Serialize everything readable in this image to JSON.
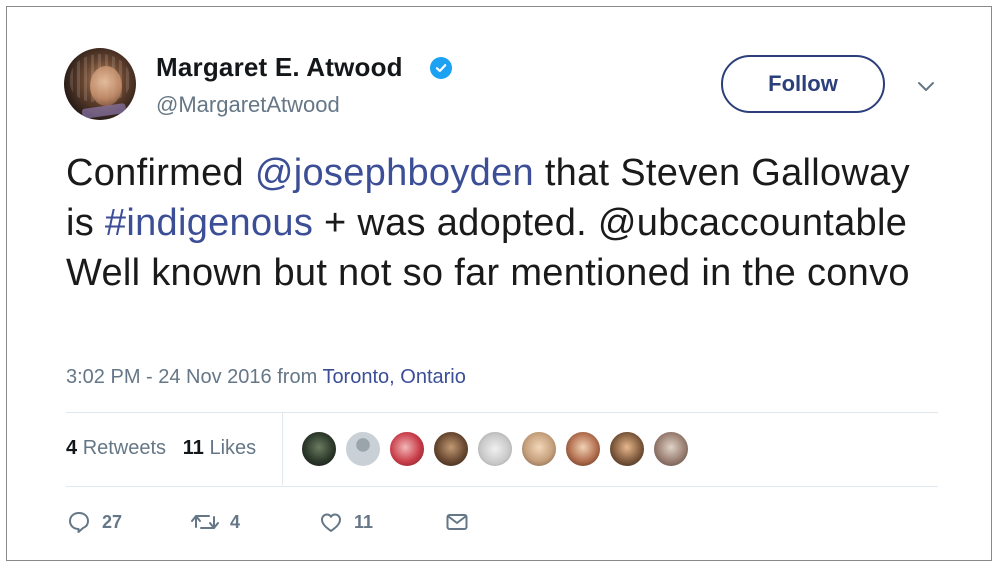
{
  "tweet": {
    "author": {
      "name": "Margaret E. Atwood",
      "handle": "@MargaretAtwood",
      "verified": true
    },
    "follow_label": "Follow",
    "text_parts": [
      {
        "text": "Confirmed ",
        "type": "text"
      },
      {
        "text": "@josephboyden",
        "type": "mention"
      },
      {
        "text": " that Steven Galloway is ",
        "type": "text"
      },
      {
        "text": "#indigenous",
        "type": "hashtag"
      },
      {
        "text": " + was adopted. @ubcaccountable Well known but not so far mentioned in the convo",
        "type": "text"
      }
    ],
    "timestamp": "3:02 PM - 24 Nov 2016 from",
    "location": "Toronto, Ontario",
    "stats": {
      "retweets_count": "4",
      "retweets_label": "Retweets",
      "likes_count": "11",
      "likes_label": "Likes"
    },
    "actions": {
      "reply_count": "27",
      "retweet_count": "4",
      "like_count": "11"
    }
  },
  "colors": {
    "link": "#3b4e96",
    "muted": "#657786",
    "verified": "#1da1f2",
    "follow_border": "#2b3f7a"
  },
  "icons": [
    "verified-badge-icon",
    "chevron-down-icon",
    "reply-icon",
    "retweet-icon",
    "like-icon",
    "message-icon"
  ]
}
